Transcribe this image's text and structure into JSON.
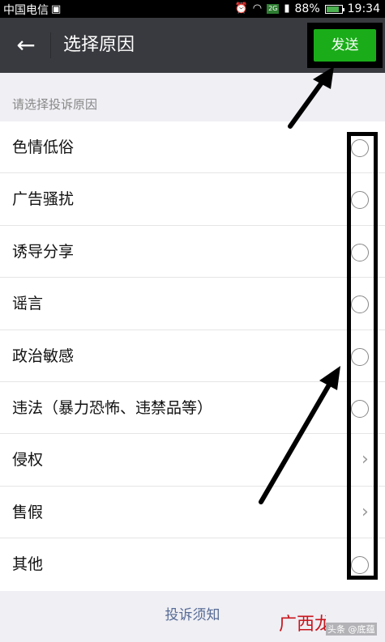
{
  "status_bar": {
    "carrier": "中国电信",
    "network": "2G",
    "battery": "88%",
    "battery_level": 0.88,
    "time": "19:34"
  },
  "header": {
    "title": "选择原因",
    "send_label": "发送"
  },
  "section_title": "请选择投诉原因",
  "reasons": [
    {
      "label": "色情低俗",
      "control": "radio"
    },
    {
      "label": "广告骚扰",
      "control": "radio"
    },
    {
      "label": "诱导分享",
      "control": "radio"
    },
    {
      "label": "谣言",
      "control": "radio"
    },
    {
      "label": "政治敏感",
      "control": "radio"
    },
    {
      "label": "违法（暴力恐怖、违禁品等）",
      "control": "radio"
    },
    {
      "label": "侵权",
      "control": "chevron"
    },
    {
      "label": "售假",
      "control": "chevron"
    },
    {
      "label": "其他",
      "control": "radio"
    }
  ],
  "footer": {
    "link": "投诉须知"
  },
  "watermark": {
    "logo_text": "广西龙网",
    "small_text": "头条 @底蕴"
  },
  "colors": {
    "title_bar": "#393a3f",
    "send_button": "#1aad19",
    "link": "#576b95",
    "watermark_red": "#c8161d"
  }
}
